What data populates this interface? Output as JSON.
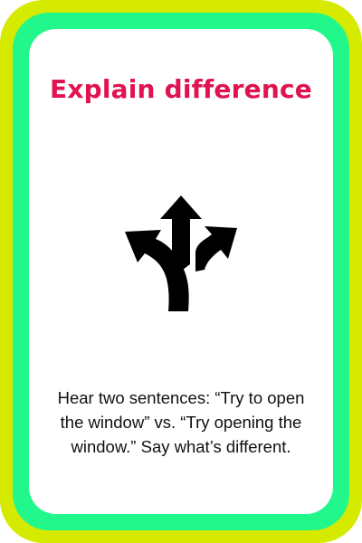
{
  "card": {
    "title": "Explain difference",
    "description": "Hear two sentences: “Try to open the window” vs. “Try opening the window.” Say what’s different.",
    "icon": "fork-arrows-icon"
  },
  "colors": {
    "outer_border": "#d6ea00",
    "inner_border": "#22f78c",
    "title": "#e0124f",
    "background": "#ffffff",
    "text": "#111111"
  }
}
